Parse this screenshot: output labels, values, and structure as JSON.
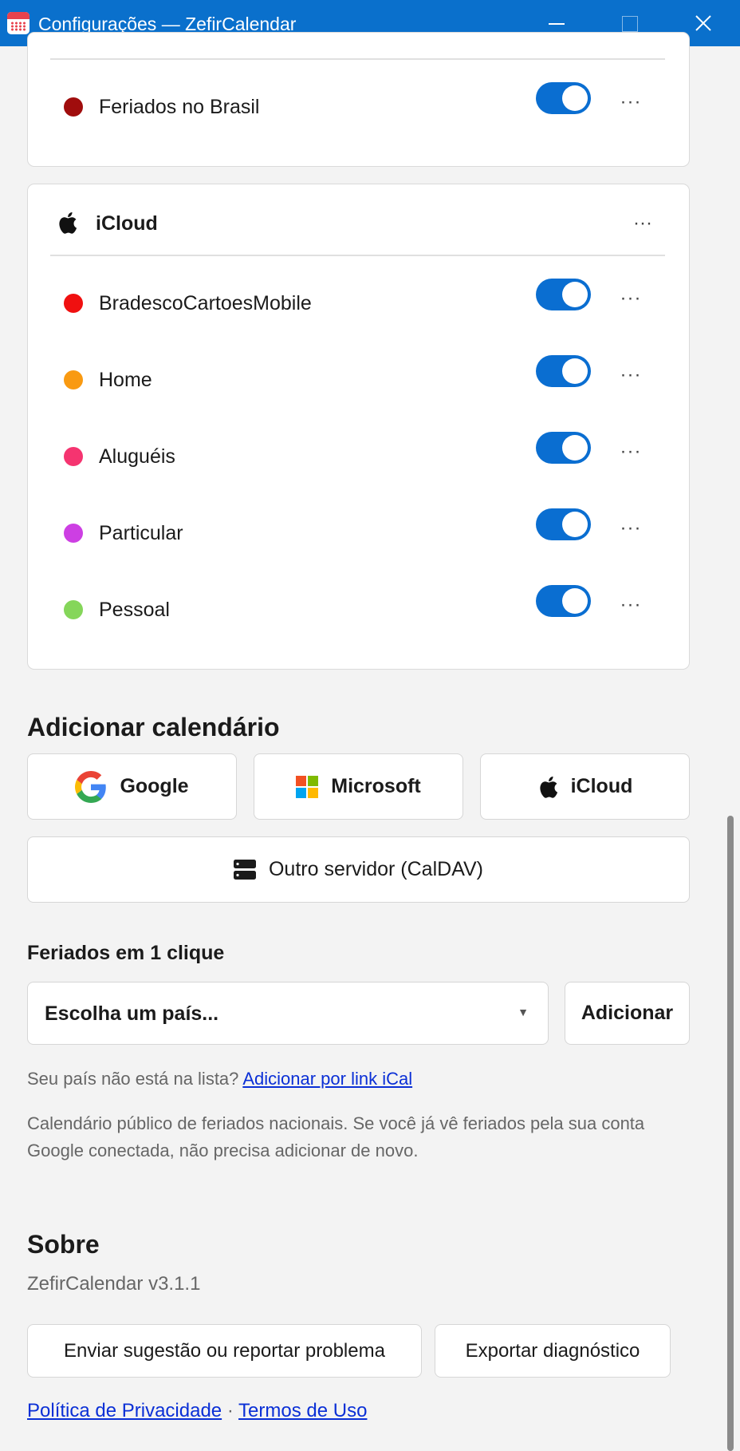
{
  "window": {
    "title": "Configurações — ZefirCalendar",
    "controls": {
      "minimize": "minimize",
      "maximize": "maximize",
      "close": "close"
    }
  },
  "google_account": {
    "calendars": [
      {
        "name": "Feriados no Brasil",
        "color": "#a00d0d",
        "enabled": true
      }
    ]
  },
  "icloud_account": {
    "name": "iCloud",
    "more": "···",
    "calendars": [
      {
        "name": "BradescoCartoesMobile",
        "color": "#f01010",
        "enabled": true
      },
      {
        "name": "Home",
        "color": "#f99a12",
        "enabled": true
      },
      {
        "name": "Aluguéis",
        "color": "#f53470",
        "enabled": true
      },
      {
        "name": "Particular",
        "color": "#cd3fe3",
        "enabled": true
      },
      {
        "name": "Pessoal",
        "color": "#85d65a",
        "enabled": true
      }
    ]
  },
  "more_label": "···",
  "add_calendar": {
    "heading": "Adicionar calendário",
    "google": "Google",
    "microsoft": "Microsoft",
    "icloud": "iCloud",
    "caldav": "Outro servidor (CalDAV)"
  },
  "holidays": {
    "heading": "Feriados em 1 clique",
    "select_placeholder": "Escolha um país...",
    "add_button": "Adicionar",
    "hint_text": "Seu país não está na lista?",
    "hint_link": "Adicionar por link iCal",
    "description": "Calendário público de feriados nacionais. Se você já vê feriados pela sua conta Google conectada, não precisa adicionar de novo."
  },
  "about": {
    "heading": "Sobre",
    "version": "ZefirCalendar v3.1.1",
    "feedback_button": "Enviar sugestão ou reportar problema",
    "export_button": "Exportar diagnóstico",
    "privacy_link": "Política de Privacidade",
    "separator": "·",
    "terms_link": "Termos de Uso"
  },
  "colors": {
    "accent": "#0a6ed1",
    "titlebar": "#0a70cc",
    "link": "#0a2fd6"
  }
}
